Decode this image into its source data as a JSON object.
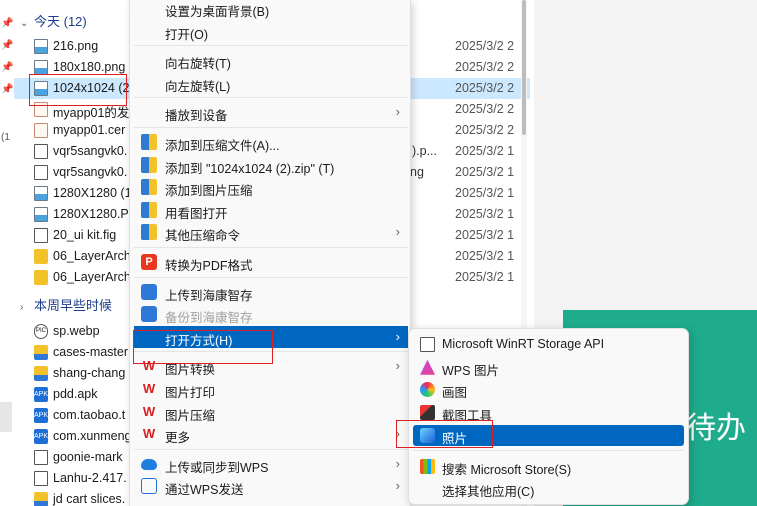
{
  "left_pins": {
    "marker_text": "(1"
  },
  "explorer": {
    "groups": [
      {
        "label": "今天 (12)"
      },
      {
        "label": "本周早些时候"
      }
    ],
    "today_rows": [
      {
        "name": "216.png",
        "date": "2025/3/2 2",
        "icon": "png-file-icon"
      },
      {
        "name": "180x180.png",
        "date": "2025/3/2 2",
        "icon": "png-file-icon"
      },
      {
        "name": "1024x1024 (2",
        "date": "2025/3/2 2",
        "icon": "png-file-icon",
        "selected": true
      },
      {
        "name": "myapp01的发",
        "date": "2025/3/2 2",
        "icon": "cert-file-icon"
      },
      {
        "name": "myapp01.cer",
        "date": "2025/3/2 2",
        "icon": "cert-file-icon"
      },
      {
        "name": "vqr5sangvk0.",
        "date": "2025/3/2 1",
        "icon": "document-file-icon",
        "extra": ").p..."
      },
      {
        "name": "vqr5sangvk0.",
        "date": "2025/3/2 1",
        "icon": "document-file-icon",
        "extra": "ng"
      },
      {
        "name": "1280X1280 (1",
        "date": "2025/3/2 1",
        "icon": "png-file-icon"
      },
      {
        "name": "1280X1280.PI",
        "date": "2025/3/2 1",
        "icon": "png-file-icon"
      },
      {
        "name": "20_ui kit.fig",
        "date": "2025/3/2 1",
        "icon": "fig-file-icon"
      },
      {
        "name": "06_LayerArch",
        "date": "2025/3/2 1",
        "icon": "folder-icon"
      },
      {
        "name": "06_LayerArch",
        "date": "2025/3/2 1",
        "icon": "folder-icon"
      }
    ],
    "week_rows": [
      {
        "name": "sp.webp",
        "icon": "webp-file-icon"
      },
      {
        "name": "cases-master",
        "icon": "zip-folder-icon"
      },
      {
        "name": "shang-chang",
        "icon": "zip-folder-icon"
      },
      {
        "name": "pdd.apk",
        "icon": "apk-file-icon"
      },
      {
        "name": "com.taobao.t",
        "icon": "apk-file-icon"
      },
      {
        "name": "com.xunmeng",
        "icon": "apk-file-icon"
      },
      {
        "name": "goonie-mark",
        "icon": "document-file-icon"
      },
      {
        "name": "Lanhu-2.417.",
        "icon": "lanhu-app-icon"
      },
      {
        "name": "jd cart slices.",
        "icon": "zip-folder-icon"
      }
    ]
  },
  "right_panel": {
    "green_text": "待办",
    "accent_color": "#1fac8d"
  },
  "context_menu": {
    "items": [
      {
        "label": "设置为桌面背景(B)",
        "icon": "",
        "arrow": false
      },
      {
        "label": "打开(O)",
        "icon": "",
        "arrow": false
      },
      {
        "sep": true
      },
      {
        "label": "向右旋转(T)",
        "icon": "",
        "arrow": false
      },
      {
        "label": "向左旋转(L)",
        "icon": "",
        "arrow": false
      },
      {
        "sep": true
      },
      {
        "label": "播放到设备",
        "icon": "",
        "arrow": true
      },
      {
        "sep": true
      },
      {
        "label": "添加到压缩文件(A)...",
        "icon": "archive-icon",
        "arrow": false
      },
      {
        "label": "添加到 \"1024x1024 (2).zip\" (T)",
        "icon": "archive-icon",
        "arrow": false
      },
      {
        "label": "添加到图片压缩",
        "icon": "archive-icon",
        "arrow": false
      },
      {
        "label": "用看图打开",
        "icon": "archive-icon",
        "arrow": false
      },
      {
        "label": "其他压缩命令",
        "icon": "archive-icon",
        "arrow": true
      },
      {
        "sep": true
      },
      {
        "label": "转换为PDF格式",
        "icon": "pdf-icon",
        "arrow": false
      },
      {
        "sep": true
      },
      {
        "label": "上传到海康智存",
        "icon": "hik-icon",
        "arrow": false
      },
      {
        "label": "备份到海康智存",
        "icon": "hik-icon",
        "arrow": false,
        "disabled": true
      },
      {
        "label": "打开方式(H)",
        "icon": "",
        "arrow": true,
        "highlighted": true
      },
      {
        "sep": true
      },
      {
        "label": "图片转换",
        "icon": "wps-icon",
        "arrow": true
      },
      {
        "label": "图片打印",
        "icon": "wps-icon",
        "arrow": false
      },
      {
        "label": "图片压缩",
        "icon": "wps-icon",
        "arrow": false
      },
      {
        "label": "更多",
        "icon": "wps-icon",
        "arrow": true
      },
      {
        "sep": true
      },
      {
        "label": "上传或同步到WPS",
        "icon": "cloud-icon",
        "arrow": true
      },
      {
        "label": "通过WPS发送",
        "icon": "send-icon",
        "arrow": true
      }
    ]
  },
  "submenu": {
    "items": [
      {
        "label": "Microsoft WinRT Storage API",
        "icon": "document-icon"
      },
      {
        "label": "WPS 图片",
        "icon": "wps-picture-icon"
      },
      {
        "label": "画图",
        "icon": "paint-icon"
      },
      {
        "label": "截图工具",
        "icon": "snipping-tool-icon"
      },
      {
        "label": "照片",
        "icon": "photos-icon",
        "highlighted": true
      },
      {
        "sep": true
      },
      {
        "label": "搜索 Microsoft Store(S)",
        "icon": "store-icon"
      },
      {
        "label": "选择其他应用(C)",
        "icon": ""
      }
    ]
  },
  "colors": {
    "highlight": "#0067c0",
    "annotation": "#e02020",
    "selection": "#cce8ff"
  }
}
